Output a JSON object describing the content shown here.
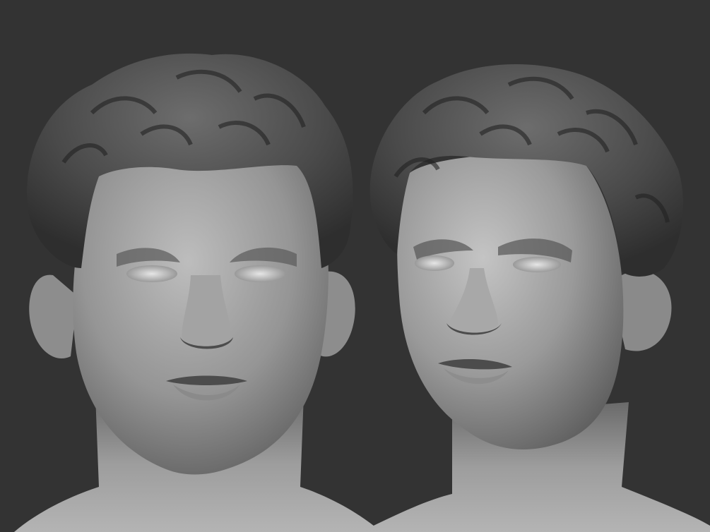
{
  "scene": {
    "description_kind": "3d-sculpt-render",
    "views": [
      {
        "view": "front"
      },
      {
        "view": "three-quarter-right"
      }
    ]
  },
  "colors": {
    "background": "#333333",
    "skin_light": "#b9b9b9",
    "skin_mid": "#8f8f8f",
    "skin_dark": "#4c4c4c",
    "hair_light": "#6e6e6e",
    "hair_dark": "#2e2e2e"
  }
}
